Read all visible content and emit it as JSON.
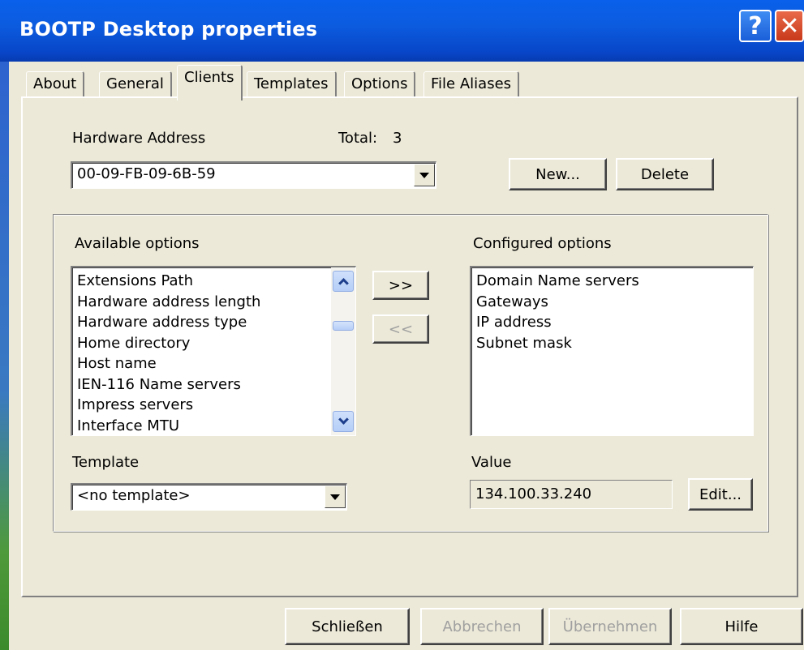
{
  "window": {
    "title": "BOOTP Desktop properties",
    "help_glyph": "?",
    "close_glyph": "✕"
  },
  "tabs": [
    {
      "label": "About"
    },
    {
      "label": "General"
    },
    {
      "label": "Clients"
    },
    {
      "label": "Templates"
    },
    {
      "label": "Options"
    },
    {
      "label": "File Aliases"
    }
  ],
  "active_tab": "Clients",
  "hardware": {
    "label": "Hardware Address",
    "total_label": "Total:",
    "total_value": "3",
    "selected": "00-09-FB-09-6B-59",
    "new_label": "New...",
    "delete_label": "Delete"
  },
  "available": {
    "label": "Available options",
    "items": [
      "Extensions Path",
      "Hardware address length",
      "Hardware address type",
      "Home directory",
      "Host name",
      "IEN-116 Name servers",
      "Impress servers",
      "Interface MTU"
    ]
  },
  "transfer": {
    "add_label": ">>",
    "remove_label": "<<"
  },
  "configured": {
    "label": "Configured options",
    "items": [
      "Domain Name servers",
      "Gateways",
      "IP address",
      "Subnet mask"
    ]
  },
  "template": {
    "label": "Template",
    "selected": "<no template>"
  },
  "value": {
    "label": "Value",
    "text": "134.100.33.240",
    "edit_label": "Edit..."
  },
  "footer": {
    "close_label": "Schließen",
    "cancel_label": "Abbrechen",
    "apply_label": "Übernehmen",
    "help_label": "Hilfe"
  }
}
